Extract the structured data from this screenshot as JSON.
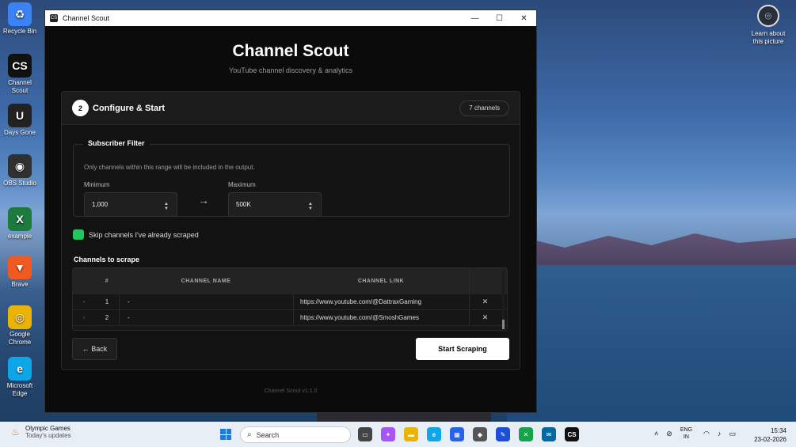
{
  "desktop": {
    "icons": [
      {
        "name": "recycle-bin",
        "label": "Recycle Bin",
        "color": "#3b82f6"
      },
      {
        "name": "channel-scout",
        "label": "Channel Scout",
        "color": "#111111"
      },
      {
        "name": "days-gone",
        "label": "Days Gone",
        "color": "#222222"
      },
      {
        "name": "obs-studio",
        "label": "OBS Studio",
        "color": "#303030"
      },
      {
        "name": "example",
        "label": "example",
        "color": "#1d7a3f"
      },
      {
        "name": "brave",
        "label": "Brave",
        "color": "#f05a22"
      },
      {
        "name": "google-chrome",
        "label": "Google Chrome",
        "color": "#eab308"
      },
      {
        "name": "microsoft-edge",
        "label": "Microsoft Edge",
        "color": "#0ea5e9"
      }
    ],
    "learn_label": "Learn about this picture"
  },
  "window": {
    "title": "Channel Scout",
    "controls": {
      "minimize": "—",
      "maximize": "☐",
      "close": "✕"
    }
  },
  "app": {
    "title": "Channel Scout",
    "subtitle": "YouTube channel discovery & analytics",
    "version": "Channel Scout v1.1.0"
  },
  "card": {
    "step": "2",
    "title": "Configure & Start",
    "badge": "7 channels"
  },
  "filter": {
    "legend": "Subscriber Filter",
    "description": "Only channels within this range will be included in the output.",
    "min_label": "Minimum",
    "min_value": "1,000",
    "max_label": "Maximum",
    "max_value": "500K",
    "arrow": "→"
  },
  "skip": {
    "label": "Skip channels I've already scraped",
    "checked": true,
    "color": "#22c55e"
  },
  "channels": {
    "title": "Channels to scrape",
    "columns": {
      "num": "#",
      "name": "CHANNEL NAME",
      "link": "CHANNEL LINK"
    },
    "rows": [
      {
        "num": "1",
        "name": "-",
        "link": "https://www.youtube.com/@DattraxGaming"
      },
      {
        "num": "2",
        "name": "-",
        "link": "https://www.youtube.com/@SmoshGames"
      }
    ]
  },
  "buttons": {
    "back": "← Back",
    "start": "Start Scraping"
  },
  "taskbar": {
    "news_title": "Olympic Games",
    "news_sub": "Today's updates",
    "search_placeholder": "Search",
    "lang_1": "ENG",
    "lang_2": "IN",
    "time": "15:34",
    "date": "23-02-2026",
    "active_app": "CS"
  }
}
